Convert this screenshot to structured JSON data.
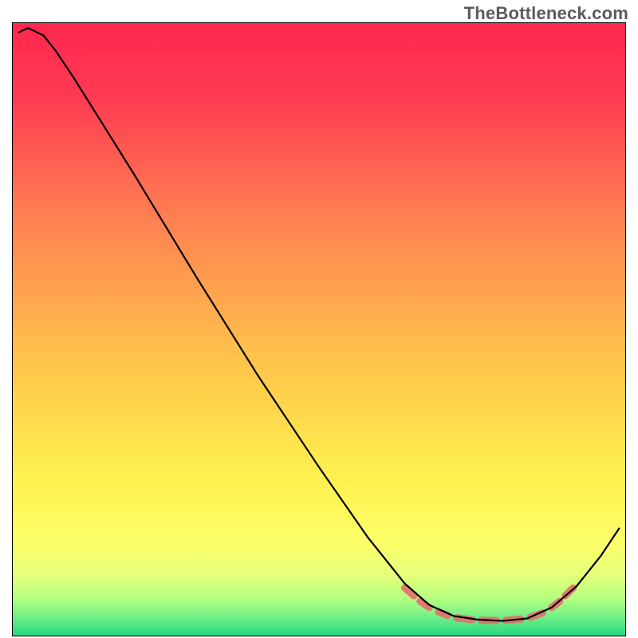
{
  "watermark": "TheBottleneck.com",
  "chart_data": {
    "type": "line",
    "title": "",
    "xlabel": "",
    "ylabel": "",
    "xlim": [
      0,
      100
    ],
    "ylim": [
      0,
      100
    ],
    "grid": false,
    "legend": false,
    "gradient_stops": [
      {
        "pct": 0,
        "color": "#ff2850"
      },
      {
        "pct": 12,
        "color": "#ff3a52"
      },
      {
        "pct": 30,
        "color": "#ff7a52"
      },
      {
        "pct": 55,
        "color": "#ffc44b"
      },
      {
        "pct": 75,
        "color": "#fff250"
      },
      {
        "pct": 85,
        "color": "#fcff6a"
      },
      {
        "pct": 90,
        "color": "#e6ff7a"
      },
      {
        "pct": 94,
        "color": "#b4ff80"
      },
      {
        "pct": 97,
        "color": "#6fef86"
      },
      {
        "pct": 100,
        "color": "#24d882"
      }
    ],
    "series": [
      {
        "name": "bottleneck-curve",
        "points": [
          {
            "x": 1.0,
            "y": 98.5
          },
          {
            "x": 2.5,
            "y": 99.2
          },
          {
            "x": 5.0,
            "y": 98.0
          },
          {
            "x": 7.0,
            "y": 95.5
          },
          {
            "x": 10.0,
            "y": 91.0
          },
          {
            "x": 20.0,
            "y": 75.0
          },
          {
            "x": 30.0,
            "y": 58.5
          },
          {
            "x": 40.0,
            "y": 42.5
          },
          {
            "x": 50.0,
            "y": 27.5
          },
          {
            "x": 58.0,
            "y": 16.0
          },
          {
            "x": 64.0,
            "y": 8.5
          },
          {
            "x": 68.0,
            "y": 5.0
          },
          {
            "x": 72.0,
            "y": 3.2
          },
          {
            "x": 76.0,
            "y": 2.6
          },
          {
            "x": 80.0,
            "y": 2.4
          },
          {
            "x": 84.0,
            "y": 2.8
          },
          {
            "x": 88.0,
            "y": 4.6
          },
          {
            "x": 92.0,
            "y": 8.0
          },
          {
            "x": 96.0,
            "y": 13.0
          },
          {
            "x": 99.0,
            "y": 17.5
          }
        ]
      }
    ],
    "highlight_dashes": [
      {
        "x1": 64.0,
        "y1": 7.8,
        "x2": 65.5,
        "y2": 6.5
      },
      {
        "x1": 66.5,
        "y1": 5.6,
        "x2": 68.0,
        "y2": 4.6
      },
      {
        "x1": 69.5,
        "y1": 3.9,
        "x2": 71.0,
        "y2": 3.3
      },
      {
        "x1": 72.5,
        "y1": 2.9,
        "x2": 75.0,
        "y2": 2.6
      },
      {
        "x1": 76.5,
        "y1": 2.5,
        "x2": 79.0,
        "y2": 2.45
      },
      {
        "x1": 80.5,
        "y1": 2.5,
        "x2": 83.0,
        "y2": 2.7
      },
      {
        "x1": 84.5,
        "y1": 3.0,
        "x2": 86.5,
        "y2": 3.7
      },
      {
        "x1": 88.0,
        "y1": 4.6,
        "x2": 89.3,
        "y2": 5.6
      },
      {
        "x1": 90.2,
        "y1": 6.5,
        "x2": 91.5,
        "y2": 7.8
      }
    ],
    "colors": {
      "curve": "#000000",
      "dash": "#e46f6d",
      "watermark": "#5a5a5a"
    }
  }
}
